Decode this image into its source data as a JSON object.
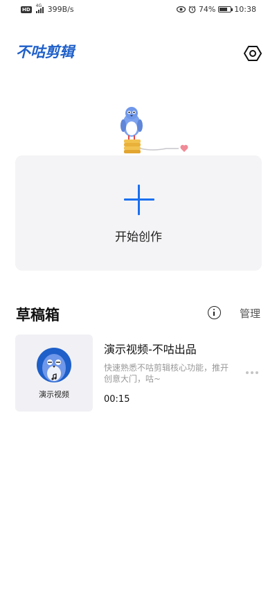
{
  "status_bar": {
    "hd": "HD",
    "network": "4G",
    "speed": "399B/s",
    "battery": "74%",
    "time": "10:38",
    "battery_level": 0.74
  },
  "header": {
    "logo": "不咕剪辑",
    "settings_icon": "hexagon-settings-icon"
  },
  "create": {
    "label": "开始创作",
    "icon": "plus-icon",
    "accent": "#1a6ff0"
  },
  "drafts": {
    "title": "草稿箱",
    "info_icon": "info-icon",
    "manage": "管理",
    "items": [
      {
        "thumb_label": "演示视频",
        "title": "演示视频-不咕出品",
        "desc": "快速熟悉不咕剪辑核心功能，推开创意大门，咕~",
        "duration": "00:15"
      }
    ]
  },
  "colors": {
    "brand": "#1e5fc9",
    "accent": "#1a6ff0",
    "card_bg": "#f4f4f6"
  }
}
